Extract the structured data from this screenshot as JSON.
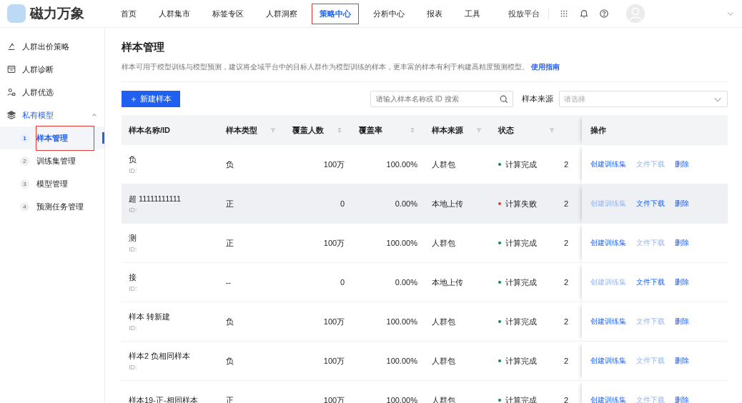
{
  "brand": {
    "name": "磁力万象"
  },
  "nav": [
    {
      "label": "首页",
      "selected": false
    },
    {
      "label": "人群集市",
      "selected": false
    },
    {
      "label": "标签专区",
      "selected": false
    },
    {
      "label": "人群洞察",
      "selected": false
    },
    {
      "label": "策略中心",
      "selected": true
    },
    {
      "label": "分析中心",
      "selected": false
    },
    {
      "label": "报表",
      "selected": false
    },
    {
      "label": "工具",
      "selected": false
    }
  ],
  "header_right": {
    "link": "投放平台"
  },
  "sidebar": {
    "items": [
      {
        "label": "人群出价策略",
        "expanded": false
      },
      {
        "label": "人群诊断",
        "expanded": false
      },
      {
        "label": "人群优选",
        "expanded": false
      },
      {
        "label": "私有模型",
        "expanded": true,
        "children": [
          {
            "number": "1",
            "label": "样本管理",
            "selected": true
          },
          {
            "number": "2",
            "label": "训练集管理",
            "selected": false
          },
          {
            "number": "3",
            "label": "模型管理",
            "selected": false
          },
          {
            "number": "4",
            "label": "预测任务管理",
            "selected": false
          }
        ]
      }
    ]
  },
  "page": {
    "title": "样本管理",
    "description": "样本可用于模型训练与模型预测，建议将全域平台中的目标人群作为模型训练的样本，更丰富的样本有利于构建高精度预测模型。",
    "guide_link": "使用指南"
  },
  "toolbar": {
    "new_button": "新建样本",
    "search": {
      "placeholder": "请输入样本名称或 ID 搜索"
    },
    "source_filter": {
      "label": "样本来源",
      "placeholder": "请选择"
    }
  },
  "table": {
    "columns": [
      {
        "label": "样本名称/ID",
        "kind": "plain"
      },
      {
        "label": "样本类型",
        "kind": "filter"
      },
      {
        "label": "覆盖人数",
        "kind": "sort"
      },
      {
        "label": "覆盖率",
        "kind": "sort"
      },
      {
        "label": "样本来源",
        "kind": "filter"
      },
      {
        "label": "状态",
        "kind": "filter"
      },
      {
        "label": "操作",
        "kind": "plain"
      }
    ],
    "rows": [
      {
        "name": "负",
        "id": "ID:",
        "type": "负",
        "count": "100万",
        "rate": "100.00%",
        "source": "人群包",
        "status": {
          "text": "计算完成",
          "kind": "done"
        },
        "column_7": "2",
        "hovered": false,
        "actions": [
          {
            "label": "创建训练集",
            "disabled": false
          },
          {
            "label": "文件下载",
            "disabled": true
          },
          {
            "label": "删除",
            "disabled": false
          }
        ]
      },
      {
        "name": "超 11111111111",
        "id": "ID:",
        "type": "正",
        "count": "0",
        "rate": "0.00%",
        "source": "本地上传",
        "status": {
          "text": "计算失败",
          "kind": "failed"
        },
        "column_7": "2",
        "hovered": true,
        "actions": [
          {
            "label": "创建训练集",
            "disabled": true
          },
          {
            "label": "文件下载",
            "disabled": false
          },
          {
            "label": "删除",
            "disabled": false
          }
        ]
      },
      {
        "name": "测",
        "id": "ID:",
        "type": "正",
        "count": "100万",
        "rate": "100.00%",
        "source": "人群包",
        "status": {
          "text": "计算完成",
          "kind": "done"
        },
        "column_7": "2",
        "hovered": false,
        "actions": [
          {
            "label": "创建训练集",
            "disabled": false
          },
          {
            "label": "文件下载",
            "disabled": true
          },
          {
            "label": "删除",
            "disabled": false
          }
        ]
      },
      {
        "name": "接",
        "id": "ID:",
        "type": "--",
        "count": "0",
        "rate": "0.00%",
        "source": "本地上传",
        "status": {
          "text": "计算完成",
          "kind": "done"
        },
        "column_7": "2",
        "hovered": false,
        "actions": [
          {
            "label": "创建训练集",
            "disabled": true
          },
          {
            "label": "文件下载",
            "disabled": false
          },
          {
            "label": "删除",
            "disabled": false
          }
        ]
      },
      {
        "name": "样本 转新建",
        "id": "ID:",
        "type": "负",
        "count": "100万",
        "rate": "100.00%",
        "source": "人群包",
        "status": {
          "text": "计算完成",
          "kind": "done"
        },
        "column_7": "2",
        "hovered": false,
        "actions": [
          {
            "label": "创建训练集",
            "disabled": false
          },
          {
            "label": "文件下载",
            "disabled": true
          },
          {
            "label": "删除",
            "disabled": false
          }
        ]
      },
      {
        "name": "样本2 负相同样本",
        "id": "ID:",
        "type": "负",
        "count": "100万",
        "rate": "100.00%",
        "source": "人群包",
        "status": {
          "text": "计算完成",
          "kind": "done"
        },
        "column_7": "2",
        "hovered": false,
        "actions": [
          {
            "label": "创建训练集",
            "disabled": false
          },
          {
            "label": "文件下载",
            "disabled": true
          },
          {
            "label": "删除",
            "disabled": false
          }
        ]
      },
      {
        "name": "样本19-正-相同样本",
        "type": "正",
        "count": "100万",
        "rate": "100.00%",
        "source": "人群包",
        "status": {
          "text": "计算完成",
          "kind": "done"
        },
        "column_7": "2",
        "hovered": false,
        "actions": [
          {
            "label": "创建训练集",
            "disabled": false
          },
          {
            "label": "文件下载",
            "disabled": true
          },
          {
            "label": "删除",
            "disabled": false
          }
        ]
      }
    ]
  }
}
